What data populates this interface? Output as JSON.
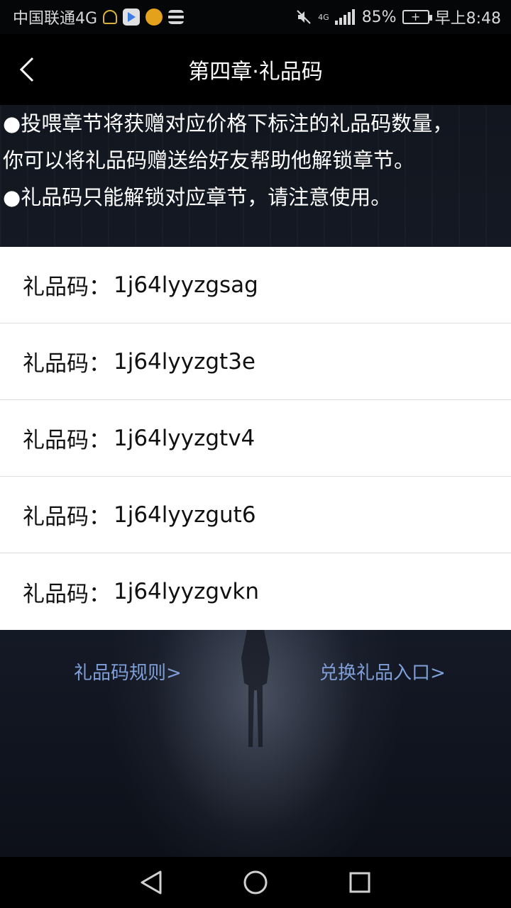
{
  "status_bar": {
    "carrier": "中国联通4G",
    "battery": "85%",
    "time": "早上8:48",
    "signal_label": "4G",
    "icons": [
      "headset-icon",
      "video-app-icon",
      "weibo-icon",
      "menu-icon",
      "mute-icon",
      "signal-icon",
      "battery-icon"
    ]
  },
  "header": {
    "title": "第四章·礼品码",
    "back_icon": "back-chevron-icon"
  },
  "notice": {
    "line1": "●投喂章节将获赠对应价格下标注的礼品码数量，",
    "line2": "你可以将礼品码赠送给好友帮助他解锁章节。",
    "line3": "●礼品码只能解锁对应章节，请注意使用。"
  },
  "codes": [
    {
      "label": "礼品码：",
      "value": "1j64lyyzgsag"
    },
    {
      "label": "礼品码：",
      "value": "1j64lyyzgt3e"
    },
    {
      "label": "礼品码：",
      "value": "1j64lyyzgtv4"
    },
    {
      "label": "礼品码：",
      "value": "1j64lyyzgut6"
    },
    {
      "label": "礼品码：",
      "value": "1j64lyyzgvkn"
    }
  ],
  "links": {
    "rules": "礼品码规则>",
    "exchange": "兑换礼品入口>"
  },
  "nav": {
    "icons": [
      "nav-back-icon",
      "nav-home-icon",
      "nav-recent-icon"
    ]
  },
  "colors": {
    "link": "#7f9fd8",
    "header_bg": "#000000",
    "list_bg": "#ffffff",
    "scene_bg": "#141926"
  }
}
